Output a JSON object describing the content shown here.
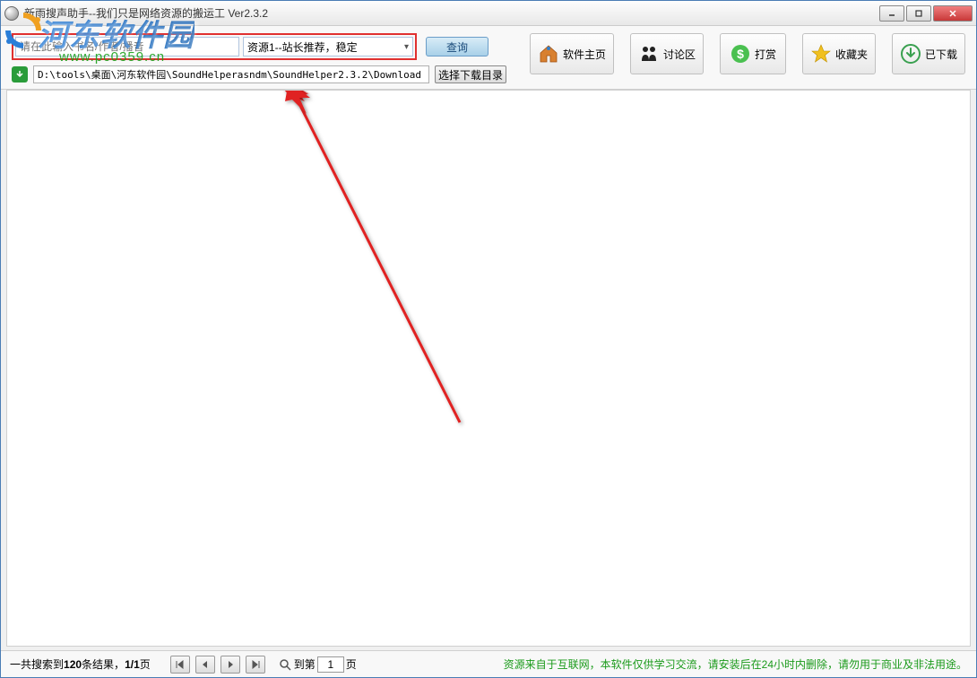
{
  "window": {
    "title": "新雨搜声助手--我们只是网络资源的搬运工 Ver2.3.2"
  },
  "search": {
    "placeholder": "请在此输入书名/作者/播音",
    "source_selected": "资源1--站长推荐，稳定",
    "query_btn": "查询"
  },
  "nav": {
    "home": "软件主页",
    "forum": "讨论区",
    "donate": "打赏",
    "favorites": "收藏夹",
    "downloaded": "已下载"
  },
  "path": {
    "value": "D:\\tools\\桌面\\河东软件园\\SoundHelperasndm\\SoundHelper2.3.2\\Download",
    "choose_btn": "选择下载目录"
  },
  "status": {
    "prefix": "一共搜索到",
    "count": "120",
    "mid": "条结果，",
    "pages": "1/1",
    "suffix": "页",
    "goto_prefix": "到第",
    "page_input": "1",
    "goto_suffix": "页"
  },
  "disclaimer": "资源来自于互联网，本软件仅供学习交流，请安装后在24小时内删除，请勿用于商业及非法用途。",
  "watermark": {
    "text": "河东软件园",
    "url": "www.pc0359.cn"
  }
}
